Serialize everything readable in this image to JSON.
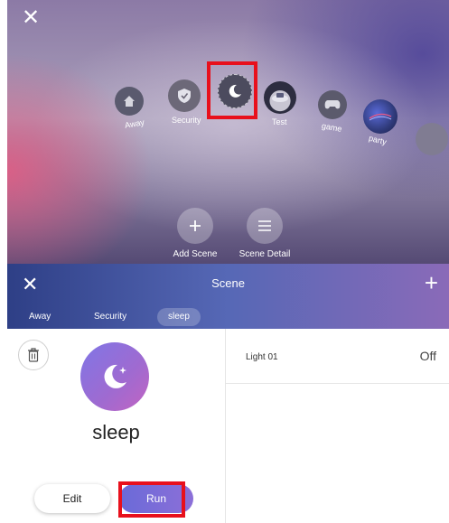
{
  "top": {
    "close_glyph": "✕",
    "scenes": [
      {
        "key": "away",
        "label": "Away",
        "icon": "house-icon",
        "color": "#5a5a6e"
      },
      {
        "key": "security",
        "label": "Security",
        "icon": "shield-icon",
        "color": "#6c6878"
      },
      {
        "key": "sleep",
        "label": "sleep",
        "icon": "moon-icon",
        "color": "#4c4b5e"
      },
      {
        "key": "test",
        "label": "Test",
        "icon": "photo-thumbnail",
        "color": "#3d3d55"
      },
      {
        "key": "game",
        "label": "game",
        "icon": "gamepad-icon",
        "color": "#5b5a6c"
      },
      {
        "key": "party",
        "label": "party",
        "icon": "photo-thumbnail",
        "color": "#2f3a7a"
      }
    ],
    "actions": [
      {
        "label": "Add Scene",
        "icon": "plus-icon"
      },
      {
        "label": "Scene Detail",
        "icon": "list-icon"
      }
    ]
  },
  "header": {
    "close_glyph": "✕",
    "title": "Scene",
    "plus_glyph": "+",
    "tabs": [
      {
        "label": "Away",
        "active": false
      },
      {
        "label": "Security",
        "active": false
      },
      {
        "label": "sleep",
        "active": true
      }
    ]
  },
  "detail": {
    "icon": "moon-icon",
    "name": "sleep",
    "edit_label": "Edit",
    "run_label": "Run"
  },
  "devices": [
    {
      "name": "Light 01",
      "state": "Off"
    }
  ],
  "colors": {
    "highlight": "#e8101c",
    "accent": "#7a6ad8",
    "header_start": "#2e3f86",
    "header_end": "#8a6ab8"
  }
}
